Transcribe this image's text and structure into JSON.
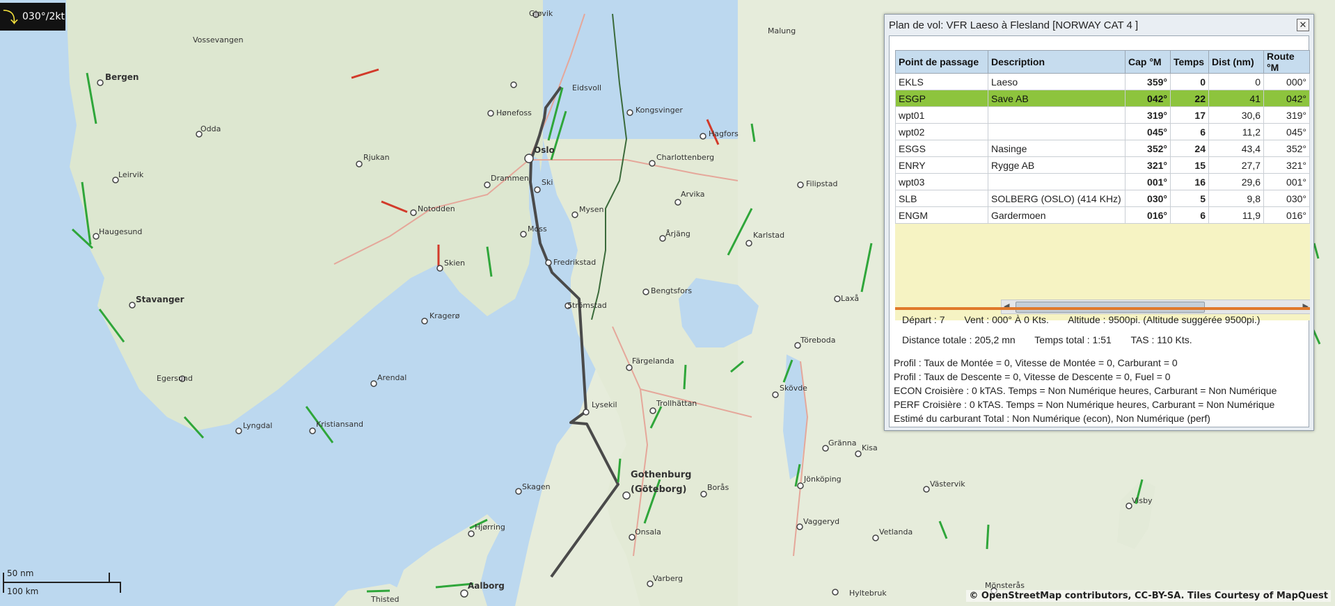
{
  "wind_indicator": {
    "text": "030°/2kt",
    "icon": "wind-arrow-icon"
  },
  "map": {
    "cities": [
      {
        "name": "Gjøvik"
      },
      {
        "name": "Malung"
      },
      {
        "name": "Vossevangen"
      },
      {
        "name": "Bergen"
      },
      {
        "name": "Eidsvoll"
      },
      {
        "name": "Hønefoss"
      },
      {
        "name": "Kongsvinger"
      },
      {
        "name": "Odda"
      },
      {
        "name": "Oslo"
      },
      {
        "name": "Hagfors"
      },
      {
        "name": "Rjukan"
      },
      {
        "name": "Charlottenberg"
      },
      {
        "name": "Leirvik"
      },
      {
        "name": "Drammen"
      },
      {
        "name": "Ski"
      },
      {
        "name": "Filipstad"
      },
      {
        "name": "Arvika"
      },
      {
        "name": "Notodden"
      },
      {
        "name": "Mysen"
      },
      {
        "name": "Haugesund"
      },
      {
        "name": "Moss"
      },
      {
        "name": "Årjäng"
      },
      {
        "name": "Karlstad"
      },
      {
        "name": "Skien"
      },
      {
        "name": "Fredrikstad"
      },
      {
        "name": "Stavanger"
      },
      {
        "name": "Bengtsfors"
      },
      {
        "name": "Laxå"
      },
      {
        "name": "Strömstad"
      },
      {
        "name": "Kragerø"
      },
      {
        "name": "Töreboda"
      },
      {
        "name": "Färgelanda"
      },
      {
        "name": "Egersund"
      },
      {
        "name": "Arendal"
      },
      {
        "name": "Skövde"
      },
      {
        "name": "Lysekil"
      },
      {
        "name": "Trollhättan"
      },
      {
        "name": "Lyngdal"
      },
      {
        "name": "Kristiansand"
      },
      {
        "name": "Gränna"
      },
      {
        "name": "Kisa"
      },
      {
        "name": "Gothenburg"
      },
      {
        "name": "(Göteborg)"
      },
      {
        "name": "Skagen"
      },
      {
        "name": "Jönköping"
      },
      {
        "name": "Västervik"
      },
      {
        "name": "Borås"
      },
      {
        "name": "Hjørring"
      },
      {
        "name": "Visby"
      },
      {
        "name": "Vaggeryd"
      },
      {
        "name": "Onsala"
      },
      {
        "name": "Vetlanda"
      },
      {
        "name": "Varberg"
      },
      {
        "name": "Aalborg"
      },
      {
        "name": "Hyltebruk"
      },
      {
        "name": "Thisted"
      },
      {
        "name": "Mönsterås"
      }
    ]
  },
  "scale": {
    "nm": "50 nm",
    "km": "100 km"
  },
  "attribution": "© OpenStreetMap contributors, CC-BY-SA. Tiles Courtesy of MapQuest",
  "flight_plan": {
    "title": "Plan de vol: VFR Laeso à Flesland [NORWAY CAT 4 ]",
    "columns": [
      "Point de passage",
      "Description",
      "Cap °M",
      "Temps",
      "Dist (nm)",
      "Route °M"
    ],
    "rows": [
      {
        "wp": "EKLS",
        "desc": "Laeso",
        "cap": "359°",
        "temps": "0",
        "dist": "0",
        "route": "000°"
      },
      {
        "wp": "ESGP",
        "desc": "Save AB",
        "cap": "042°",
        "temps": "22",
        "dist": "41",
        "route": "042°"
      },
      {
        "wp": "wpt01",
        "desc": "",
        "cap": "319°",
        "temps": "17",
        "dist": "30,6",
        "route": "319°"
      },
      {
        "wp": "wpt02",
        "desc": "",
        "cap": "045°",
        "temps": "6",
        "dist": "11,2",
        "route": "045°"
      },
      {
        "wp": "ESGS",
        "desc": "Nasinge",
        "cap": "352°",
        "temps": "24",
        "dist": "43,4",
        "route": "352°"
      },
      {
        "wp": "ENRY",
        "desc": "Rygge AB",
        "cap": "321°",
        "temps": "15",
        "dist": "27,7",
        "route": "321°"
      },
      {
        "wp": "wpt03",
        "desc": "",
        "cap": "001°",
        "temps": "16",
        "dist": "29,6",
        "route": "001°"
      },
      {
        "wp": "SLB",
        "desc": "SOLBERG (OSLO) (414 KHz)",
        "cap": "030°",
        "temps": "5",
        "dist": "9,8",
        "route": "030°"
      },
      {
        "wp": "ENGM",
        "desc": "Gardermoen",
        "cap": "016°",
        "temps": "6",
        "dist": "11,9",
        "route": "016°"
      }
    ],
    "selected_row": 1,
    "selected_color": "#8dc43d",
    "depart": "Départ :  7",
    "vent": "Vent :  000° À 0 Kts.",
    "altitude": "Altitude :  9500pi. (Altitude suggérée 9500pi.)",
    "distance_totale": "Distance totale :  205,2 mn",
    "temps_total": "Temps total :  1:51",
    "tas": "TAS :  110 Kts.",
    "profile": [
      "Profil : Taux de Montée = 0, Vitesse de Montée = 0, Carburant = 0",
      "Profil : Taux de Descente = 0, Vitesse de Descente = 0, Fuel = 0",
      "ECON Croisière : 0 kTAS. Temps = Non Numérique heures, Carburant = Non Numérique",
      "PERF Croisière : 0 kTAS. Temps = Non Numérique heures, Carburant = Non Numérique",
      "Estimé du carburant Total : Non Numérique (econ), Non Numérique (perf)"
    ]
  }
}
